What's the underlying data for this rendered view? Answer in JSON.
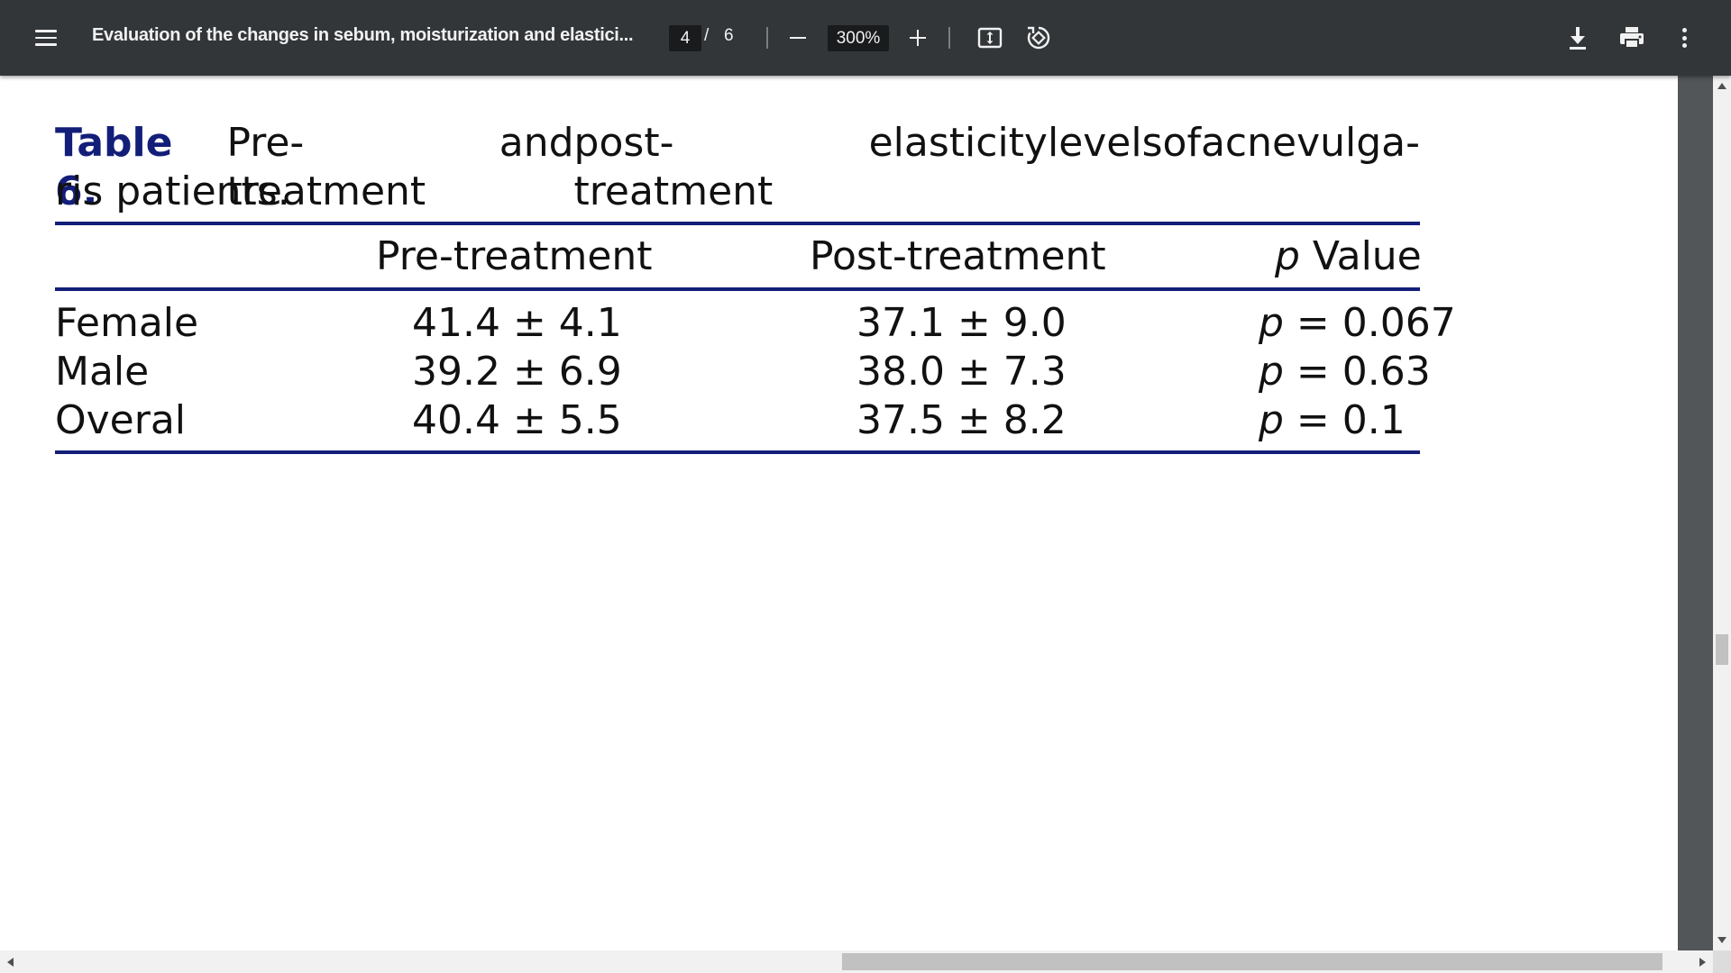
{
  "toolbar": {
    "menu_icon": "hamburger-menu-icon",
    "title": "Evaluation of the changes in sebum, moisturization and elastici...",
    "page_current": "4",
    "page_separator": "/",
    "page_total": "6",
    "zoom_level": "300%",
    "icons": [
      "zoom-out-icon",
      "zoom-in-icon",
      "fit-page-icon",
      "rotate-icon",
      "download-icon",
      "print-icon",
      "more-vert-icon"
    ]
  },
  "document": {
    "caption": {
      "label": "Table 6.",
      "line1_words": [
        "Pre-treatment",
        "and",
        "post-treatment",
        "elasticity",
        "levels",
        "of",
        "acne",
        "vulga-"
      ],
      "line2": "ris patients."
    },
    "table": {
      "headers": {
        "pre": "Pre-treatment",
        "post": "Post-treatment",
        "p_italic": "p",
        "p_rest": " Value"
      },
      "rows": [
        {
          "label": "Female",
          "pre": "41.4 ± 4.1",
          "post": "37.1 ± 9.0",
          "p_italic": "p",
          "p_rest": " = 0.067"
        },
        {
          "label": "Male",
          "pre": "39.2 ± 6.9",
          "post": "38.0 ± 7.3",
          "p_italic": "p",
          "p_rest": " = 0.63"
        },
        {
          "label": "Overal",
          "pre": "40.4 ± 5.5",
          "post": "37.5 ± 8.2",
          "p_italic": "p",
          "p_rest": " = 0.1"
        }
      ]
    }
  },
  "colors": {
    "toolbar_bg": "#323639",
    "viewer_bg": "#525659",
    "table_rule": "#131e79",
    "caption_label": "#131e79"
  }
}
